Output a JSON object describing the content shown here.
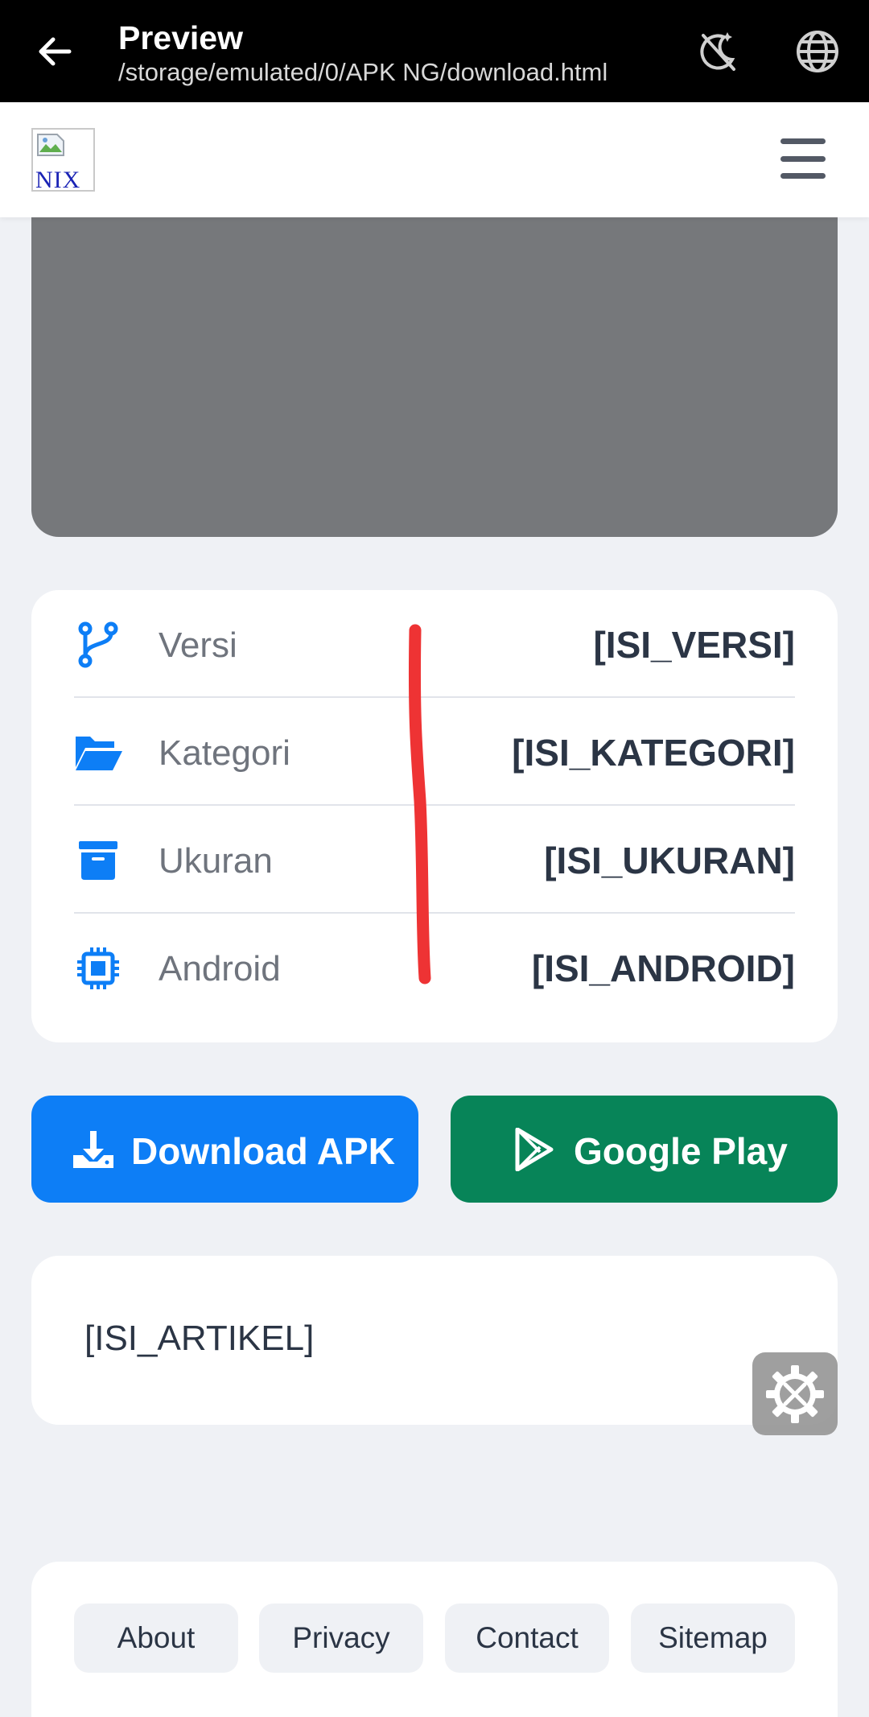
{
  "appbar": {
    "title": "Preview",
    "path": "/storage/emulated/0/APK NG/download.html",
    "icons": [
      "back-arrow-icon",
      "dark-mode-off-icon",
      "globe-icon"
    ]
  },
  "header": {
    "logo_text": "NIX",
    "menu_icon": "hamburger-menu-icon"
  },
  "info": {
    "rows": [
      {
        "label": "Versi",
        "value": "[ISI_VERSI]",
        "icon": "branch-icon"
      },
      {
        "label": "Kategori",
        "value": "[ISI_KATEGORI]",
        "icon": "folder-open-icon"
      },
      {
        "label": "Ukuran",
        "value": "[ISI_UKURAN]",
        "icon": "archive-box-icon"
      },
      {
        "label": "Android",
        "value": "[ISI_ANDROID]",
        "icon": "chip-icon"
      }
    ]
  },
  "buttons": {
    "download": "Download APK",
    "play": "Google Play"
  },
  "article": {
    "text": "[ISI_ARTIKEL]"
  },
  "footer": {
    "links": [
      "About",
      "Privacy",
      "Contact",
      "Sitemap"
    ]
  },
  "colors": {
    "accent_blue": "#0d7ef6",
    "play_green": "#078458",
    "background": "#eff1f5",
    "text_dark": "#2b3545",
    "annotation_red": "#ee3334"
  }
}
